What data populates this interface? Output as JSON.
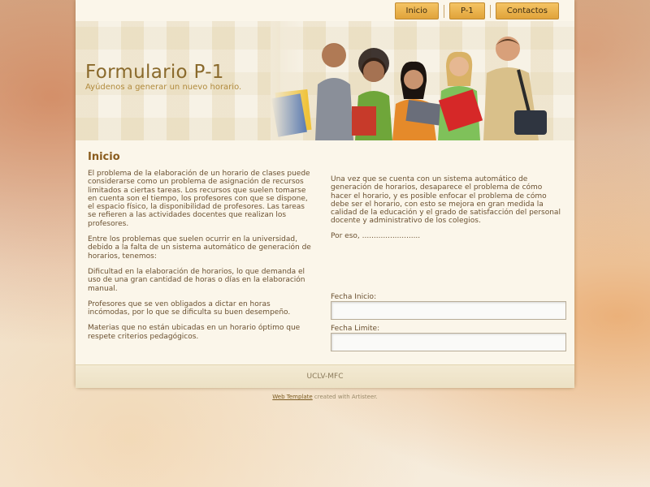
{
  "nav": {
    "items": [
      {
        "label": "Inicio"
      },
      {
        "label": "P-1"
      },
      {
        "label": "Contactos"
      }
    ]
  },
  "header": {
    "title": "Formulario P-1",
    "slogan": "Ayúdenos a generar un nuevo horario."
  },
  "content": {
    "heading": "Inicio",
    "left_paragraphs": [
      "El problema de la elaboración de un horario de clases puede considerarse como un problema de asignación de recursos limitados a ciertas tareas. Los recursos que suelen tomarse en cuenta son el tiempo, los profesores con que se dispone, el espacio físico, la disponibilidad de profesores. Las tareas se refieren a las actividades docentes que realizan los profesores.",
      "Entre los problemas que suelen ocurrir en la universidad, debido a la falta de un sistema automático de generación de horarios, tenemos:",
      " Dificultad en la elaboración de horarios, lo que demanda el uso de una gran cantidad de horas o días en la elaboración manual.",
      " Profesores que se ven obligados a dictar en horas incómodas, por lo que se dificulta su buen desempeño.",
      " Materias que no están ubicadas en un horario óptimo que respete criterios pedagógicos."
    ],
    "right_paragraphs": [
      "Una vez que se cuenta con un sistema automático de generación de horarios, desaparece el problema de cómo hacer el horario, y es posible enfocar el problema de cómo debe ser el horario, con esto se mejora en gran medida la calidad de la educación y el grado de satisfacción del personal docente y administrativo de los colegios.",
      "Por eso, ........................."
    ],
    "form": {
      "start_label": "Fecha Inicio:",
      "start_value": "",
      "limit_label": "Fecha Limite:",
      "limit_value": ""
    }
  },
  "footer": {
    "text": "UCLV-MFC"
  },
  "credit": {
    "link": "Web Template",
    "text": " created with Artisteer."
  }
}
